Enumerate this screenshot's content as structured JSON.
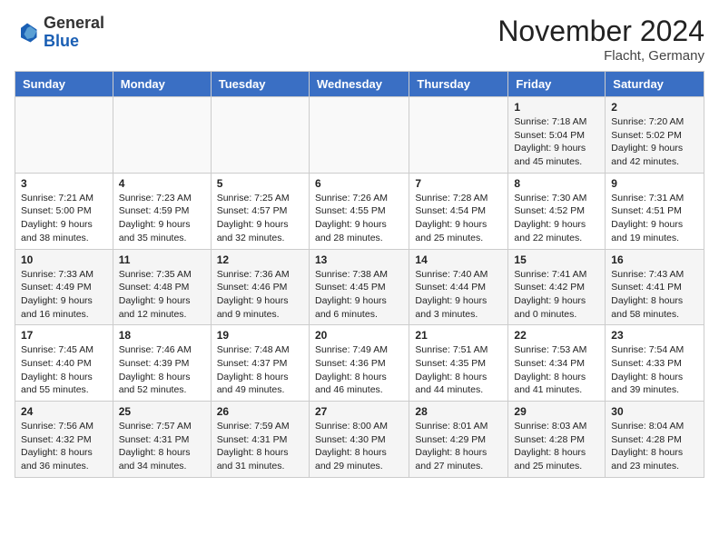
{
  "header": {
    "logo_general": "General",
    "logo_blue": "Blue",
    "month_title": "November 2024",
    "location": "Flacht, Germany"
  },
  "weekdays": [
    "Sunday",
    "Monday",
    "Tuesday",
    "Wednesday",
    "Thursday",
    "Friday",
    "Saturday"
  ],
  "weeks": [
    [
      {
        "day": "",
        "info": ""
      },
      {
        "day": "",
        "info": ""
      },
      {
        "day": "",
        "info": ""
      },
      {
        "day": "",
        "info": ""
      },
      {
        "day": "",
        "info": ""
      },
      {
        "day": "1",
        "info": "Sunrise: 7:18 AM\nSunset: 5:04 PM\nDaylight: 9 hours and 45 minutes."
      },
      {
        "day": "2",
        "info": "Sunrise: 7:20 AM\nSunset: 5:02 PM\nDaylight: 9 hours and 42 minutes."
      }
    ],
    [
      {
        "day": "3",
        "info": "Sunrise: 7:21 AM\nSunset: 5:00 PM\nDaylight: 9 hours and 38 minutes."
      },
      {
        "day": "4",
        "info": "Sunrise: 7:23 AM\nSunset: 4:59 PM\nDaylight: 9 hours and 35 minutes."
      },
      {
        "day": "5",
        "info": "Sunrise: 7:25 AM\nSunset: 4:57 PM\nDaylight: 9 hours and 32 minutes."
      },
      {
        "day": "6",
        "info": "Sunrise: 7:26 AM\nSunset: 4:55 PM\nDaylight: 9 hours and 28 minutes."
      },
      {
        "day": "7",
        "info": "Sunrise: 7:28 AM\nSunset: 4:54 PM\nDaylight: 9 hours and 25 minutes."
      },
      {
        "day": "8",
        "info": "Sunrise: 7:30 AM\nSunset: 4:52 PM\nDaylight: 9 hours and 22 minutes."
      },
      {
        "day": "9",
        "info": "Sunrise: 7:31 AM\nSunset: 4:51 PM\nDaylight: 9 hours and 19 minutes."
      }
    ],
    [
      {
        "day": "10",
        "info": "Sunrise: 7:33 AM\nSunset: 4:49 PM\nDaylight: 9 hours and 16 minutes."
      },
      {
        "day": "11",
        "info": "Sunrise: 7:35 AM\nSunset: 4:48 PM\nDaylight: 9 hours and 12 minutes."
      },
      {
        "day": "12",
        "info": "Sunrise: 7:36 AM\nSunset: 4:46 PM\nDaylight: 9 hours and 9 minutes."
      },
      {
        "day": "13",
        "info": "Sunrise: 7:38 AM\nSunset: 4:45 PM\nDaylight: 9 hours and 6 minutes."
      },
      {
        "day": "14",
        "info": "Sunrise: 7:40 AM\nSunset: 4:44 PM\nDaylight: 9 hours and 3 minutes."
      },
      {
        "day": "15",
        "info": "Sunrise: 7:41 AM\nSunset: 4:42 PM\nDaylight: 9 hours and 0 minutes."
      },
      {
        "day": "16",
        "info": "Sunrise: 7:43 AM\nSunset: 4:41 PM\nDaylight: 8 hours and 58 minutes."
      }
    ],
    [
      {
        "day": "17",
        "info": "Sunrise: 7:45 AM\nSunset: 4:40 PM\nDaylight: 8 hours and 55 minutes."
      },
      {
        "day": "18",
        "info": "Sunrise: 7:46 AM\nSunset: 4:39 PM\nDaylight: 8 hours and 52 minutes."
      },
      {
        "day": "19",
        "info": "Sunrise: 7:48 AM\nSunset: 4:37 PM\nDaylight: 8 hours and 49 minutes."
      },
      {
        "day": "20",
        "info": "Sunrise: 7:49 AM\nSunset: 4:36 PM\nDaylight: 8 hours and 46 minutes."
      },
      {
        "day": "21",
        "info": "Sunrise: 7:51 AM\nSunset: 4:35 PM\nDaylight: 8 hours and 44 minutes."
      },
      {
        "day": "22",
        "info": "Sunrise: 7:53 AM\nSunset: 4:34 PM\nDaylight: 8 hours and 41 minutes."
      },
      {
        "day": "23",
        "info": "Sunrise: 7:54 AM\nSunset: 4:33 PM\nDaylight: 8 hours and 39 minutes."
      }
    ],
    [
      {
        "day": "24",
        "info": "Sunrise: 7:56 AM\nSunset: 4:32 PM\nDaylight: 8 hours and 36 minutes."
      },
      {
        "day": "25",
        "info": "Sunrise: 7:57 AM\nSunset: 4:31 PM\nDaylight: 8 hours and 34 minutes."
      },
      {
        "day": "26",
        "info": "Sunrise: 7:59 AM\nSunset: 4:31 PM\nDaylight: 8 hours and 31 minutes."
      },
      {
        "day": "27",
        "info": "Sunrise: 8:00 AM\nSunset: 4:30 PM\nDaylight: 8 hours and 29 minutes."
      },
      {
        "day": "28",
        "info": "Sunrise: 8:01 AM\nSunset: 4:29 PM\nDaylight: 8 hours and 27 minutes."
      },
      {
        "day": "29",
        "info": "Sunrise: 8:03 AM\nSunset: 4:28 PM\nDaylight: 8 hours and 25 minutes."
      },
      {
        "day": "30",
        "info": "Sunrise: 8:04 AM\nSunset: 4:28 PM\nDaylight: 8 hours and 23 minutes."
      }
    ]
  ]
}
